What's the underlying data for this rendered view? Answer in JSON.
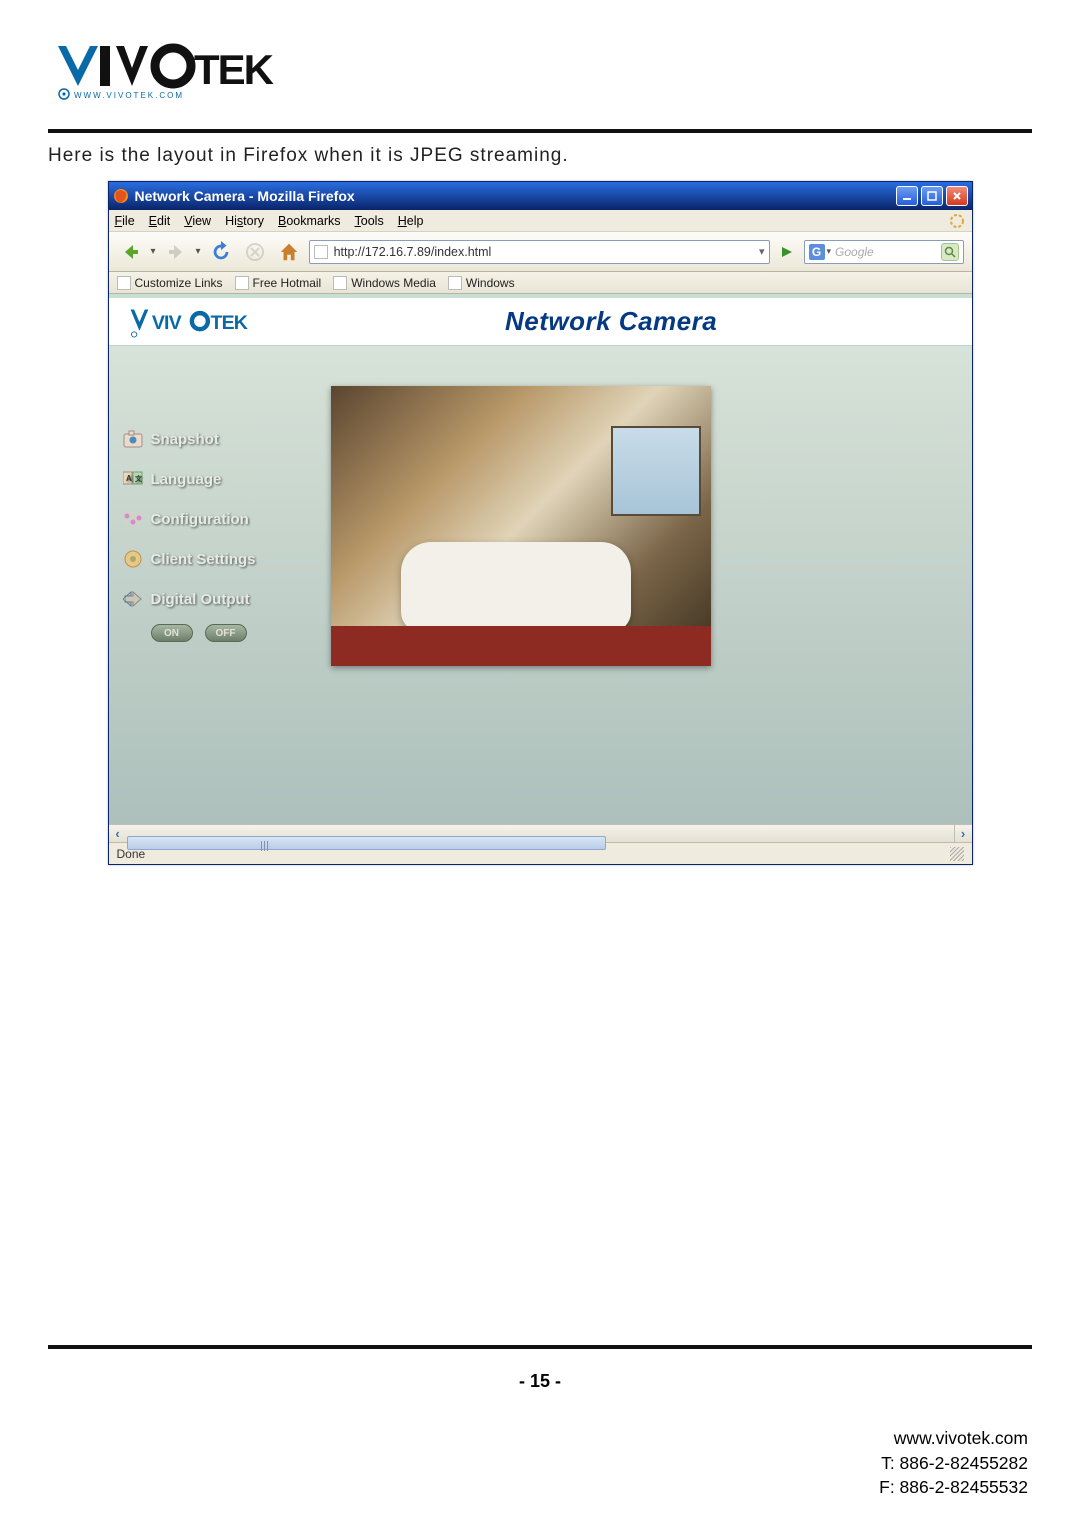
{
  "doc": {
    "intro": "Here is the layout in Firefox when it is JPEG streaming.",
    "page_number": "- 15 -",
    "website": "www.vivotek.com",
    "tel": "T: 886-2-82455282",
    "fax": "F: 886-2-82455532"
  },
  "browser": {
    "title": "Network Camera - Mozilla Firefox",
    "menu": {
      "file": "File",
      "edit": "Edit",
      "view": "View",
      "history": "History",
      "bookmarks": "Bookmarks",
      "tools": "Tools",
      "help": "Help"
    },
    "url": "http://172.16.7.89/index.html",
    "search_placeholder": "Google",
    "bookmarks_bar": [
      {
        "label": "Customize Links"
      },
      {
        "label": "Free Hotmail"
      },
      {
        "label": "Windows Media"
      },
      {
        "label": "Windows"
      }
    ],
    "status": "Done"
  },
  "page": {
    "brand": "VIVOTEK",
    "heading": "Network Camera",
    "menu": {
      "snapshot": "Snapshot",
      "language": "Language",
      "configuration": "Configuration",
      "client_settings": "Client Settings",
      "digital_output": "Digital Output"
    },
    "do_on": "ON",
    "do_off": "OFF"
  }
}
